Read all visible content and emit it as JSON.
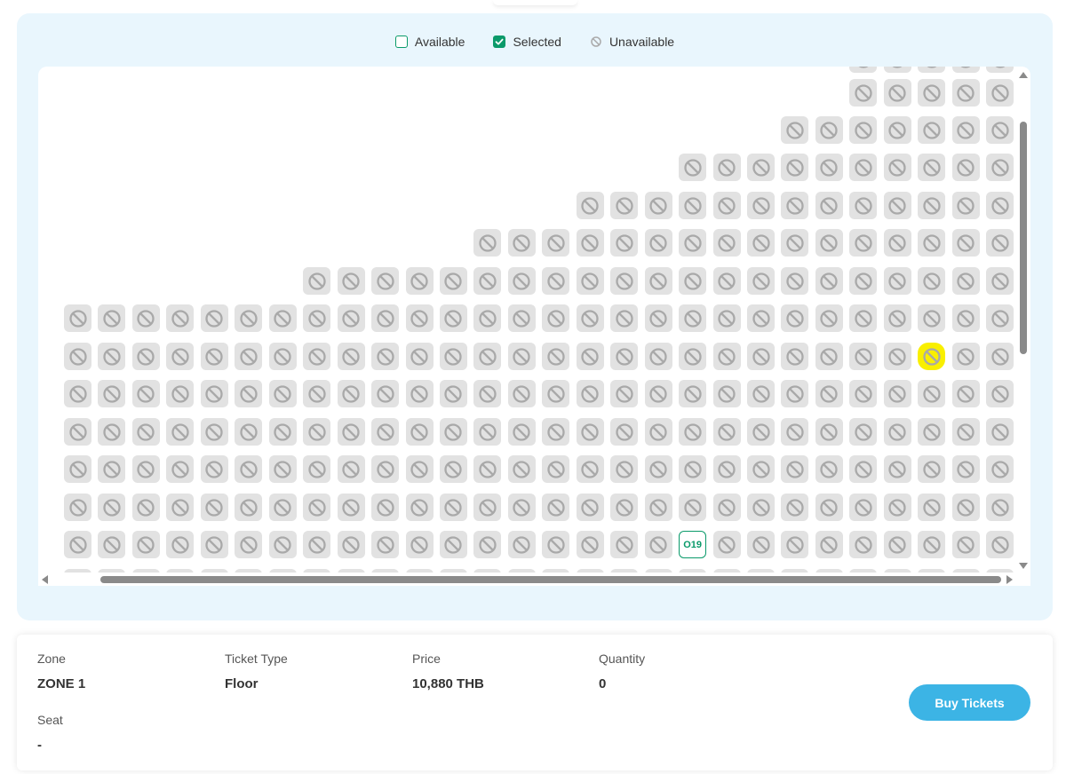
{
  "legend": {
    "available": "Available",
    "selected": "Selected",
    "unavailable": "Unavailable"
  },
  "colors": {
    "accent_green": "#0a9a6a",
    "seat_unavailable": "#e2e2e2",
    "panel_bg": "#e9f6fd",
    "buy_button": "#3cb4e5",
    "highlight": "#f9ef00"
  },
  "seat_map": {
    "available_seat_label": "O19",
    "icons": {
      "unavailable": "ban-icon",
      "selected": "check-icon"
    }
  },
  "info": {
    "zone_label": "Zone",
    "zone_value": "ZONE 1",
    "ticket_type_label": "Ticket Type",
    "ticket_type_value": "Floor",
    "price_label": "Price",
    "price_value": "10,880 THB",
    "quantity_label": "Quantity",
    "quantity_value": "0",
    "seat_label": "Seat",
    "seat_value": "-"
  },
  "buy_button_label": "Buy Tickets"
}
